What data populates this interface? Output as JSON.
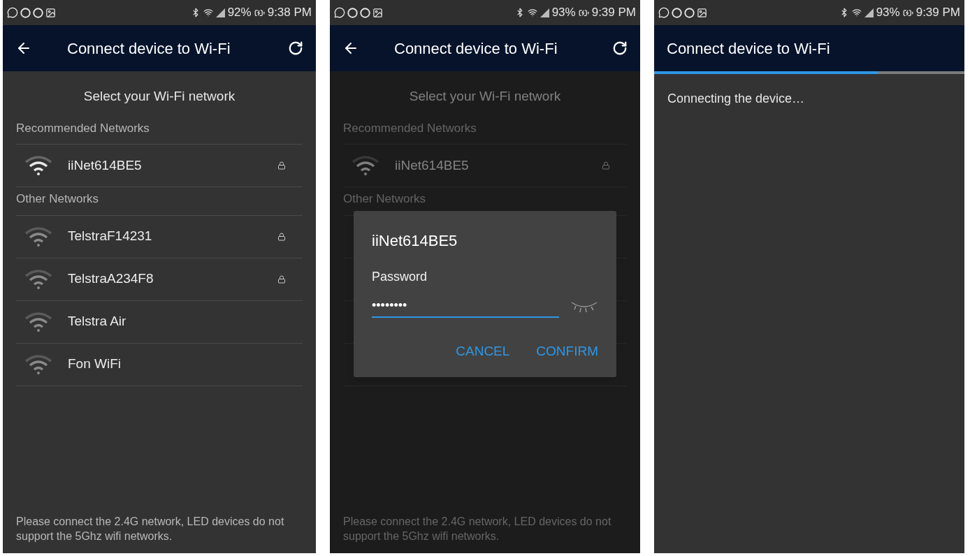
{
  "screens": [
    {
      "kind": "network_list",
      "status_bar": {
        "battery": "92%",
        "time": "9:38 PM"
      },
      "app_bar": {
        "title": "Connect device to Wi-Fi",
        "back_button": true,
        "refresh_button": true
      },
      "heading": "Select your Wi-Fi network",
      "sections": [
        {
          "label": "Recommended Networks",
          "networks": [
            {
              "name": "iiNet614BE5",
              "locked": true
            }
          ]
        },
        {
          "label": "Other Networks",
          "networks": [
            {
              "name": "TelstraF14231",
              "locked": true
            },
            {
              "name": "TelstraA234F8",
              "locked": true
            },
            {
              "name": "Telstra Air",
              "locked": false
            },
            {
              "name": "Fon WiFi",
              "locked": false
            }
          ]
        }
      ],
      "footer": "Please connect the 2.4G network, LED devices do not support the 5Ghz wifi networks."
    },
    {
      "kind": "network_list",
      "status_bar": {
        "battery": "93%",
        "time": "9:39 PM"
      },
      "app_bar": {
        "title": "Connect device to Wi-Fi",
        "back_button": true,
        "refresh_button": true
      },
      "heading": "Select your Wi-Fi network",
      "sections": [
        {
          "label": "Recommended Networks",
          "networks": [
            {
              "name": "iiNet614BE5",
              "locked": true
            }
          ]
        },
        {
          "label": "Other Networks"
        }
      ],
      "footer": "Please connect the 2.4G network, LED devices do not support the 5Ghz wifi networks.",
      "dialog": {
        "title": "iiNet614BE5",
        "label": "Password",
        "value": "••••••••",
        "buttons": [
          "CANCEL",
          "CONFIRM"
        ]
      }
    },
    {
      "kind": "connecting",
      "status_bar": {
        "battery": "93%",
        "time": "9:39 PM"
      },
      "app_bar": {
        "title": "Connect device to Wi-Fi",
        "back_button": false,
        "refresh_button": false
      },
      "progress": {
        "level": 0.72
      },
      "message": "Connecting the device…"
    }
  ]
}
